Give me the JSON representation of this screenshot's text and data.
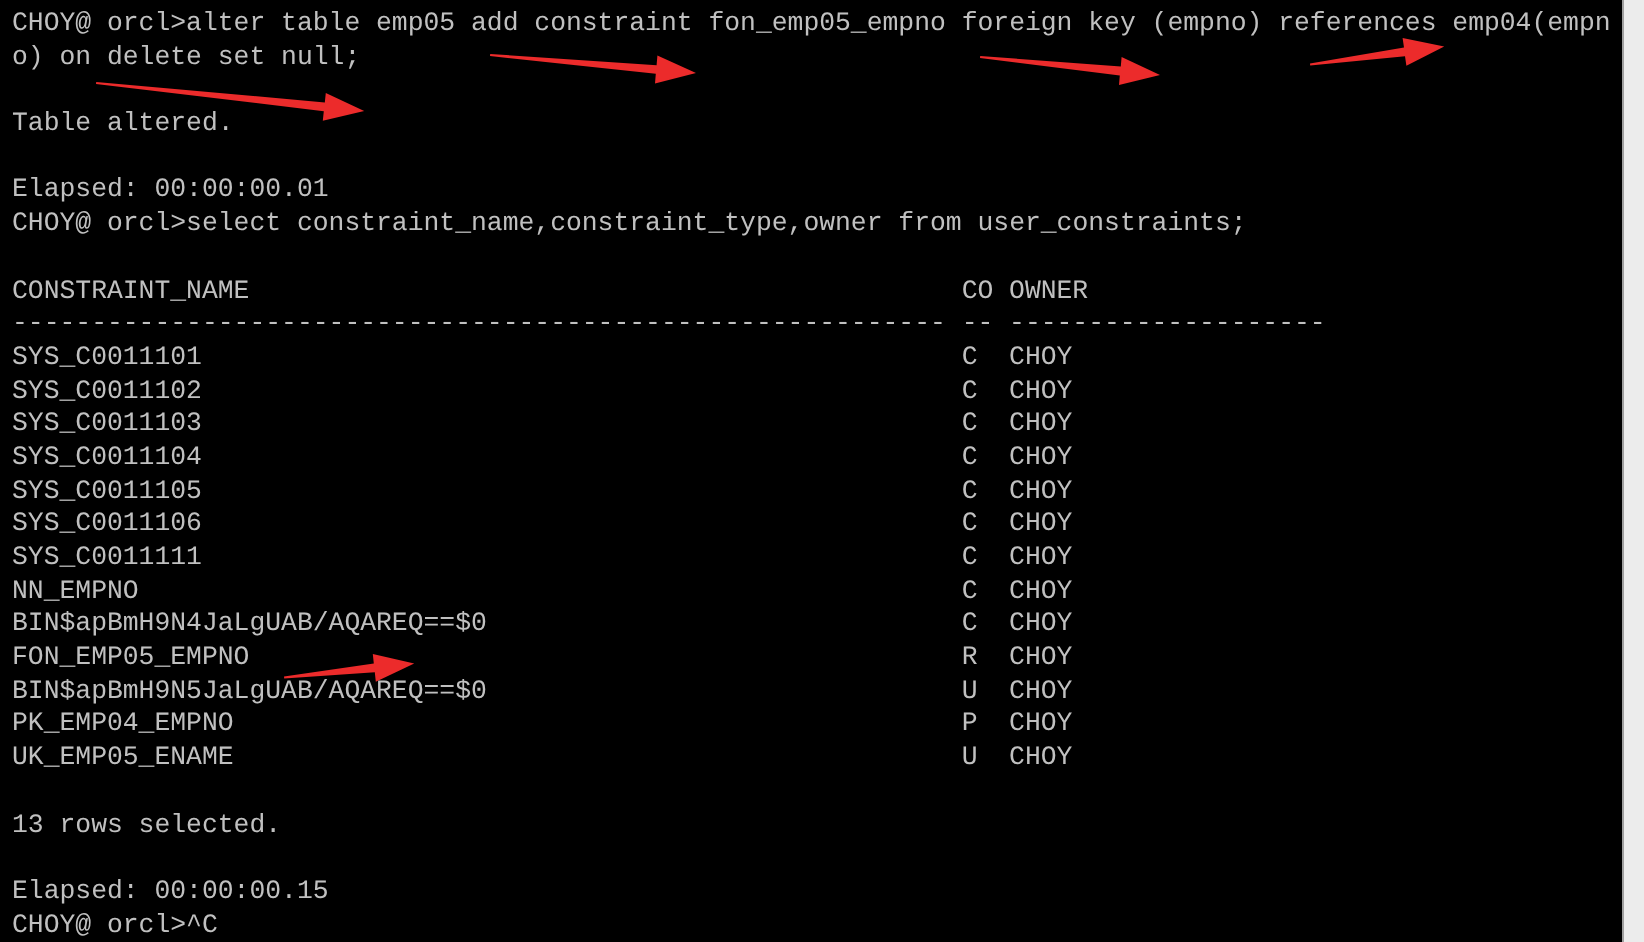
{
  "terminal": {
    "lines_before": [
      {
        "kind": "text",
        "text": "CHOY@ orcl>alter table emp05 add constraint fon_emp05_empno foreign key (empno) references emp04(empn"
      },
      {
        "kind": "text",
        "text": "o) on delete set null;"
      },
      {
        "kind": "blank"
      },
      {
        "kind": "text",
        "text": "Table altered."
      },
      {
        "kind": "blank"
      },
      {
        "kind": "text",
        "text": "Elapsed: 00:00:00.01"
      },
      {
        "kind": "text",
        "text": "CHOY@ orcl>select constraint_name,constraint_type,owner from user_constraints;"
      },
      {
        "kind": "blank"
      }
    ],
    "table": {
      "columns": [
        {
          "heading": "CONSTRAINT_NAME",
          "rule": "-----------------------------------------------------------"
        },
        {
          "heading": "CO",
          "rule": "--"
        },
        {
          "heading": "OWNER",
          "rule": "--------------------"
        }
      ],
      "rows": [
        [
          "SYS_C0011101",
          "C",
          "CHOY"
        ],
        [
          "SYS_C0011102",
          "C",
          "CHOY"
        ],
        [
          "SYS_C0011103",
          "C",
          "CHOY"
        ],
        [
          "SYS_C0011104",
          "C",
          "CHOY"
        ],
        [
          "SYS_C0011105",
          "C",
          "CHOY"
        ],
        [
          "SYS_C0011106",
          "C",
          "CHOY"
        ],
        [
          "SYS_C0011111",
          "C",
          "CHOY"
        ],
        [
          "NN_EMPNO",
          "C",
          "CHOY"
        ],
        [
          "BIN$apBmH9N4JaLgUAB/AQAREQ==$0",
          "C",
          "CHOY"
        ],
        [
          "FON_EMP05_EMPNO",
          "R",
          "CHOY"
        ],
        [
          "BIN$apBmH9N5JaLgUAB/AQAREQ==$0",
          "U",
          "CHOY"
        ],
        [
          "PK_EMP04_EMPNO",
          "P",
          "CHOY"
        ],
        [
          "UK_EMP05_ENAME",
          "U",
          "CHOY"
        ]
      ]
    },
    "lines_after": [
      {
        "kind": "blank"
      },
      {
        "kind": "text",
        "text": "13 rows selected."
      },
      {
        "kind": "blank"
      },
      {
        "kind": "text",
        "text": "Elapsed: 00:00:00.15"
      },
      {
        "kind": "text",
        "text": "CHOY@ orcl>^C"
      }
    ]
  }
}
